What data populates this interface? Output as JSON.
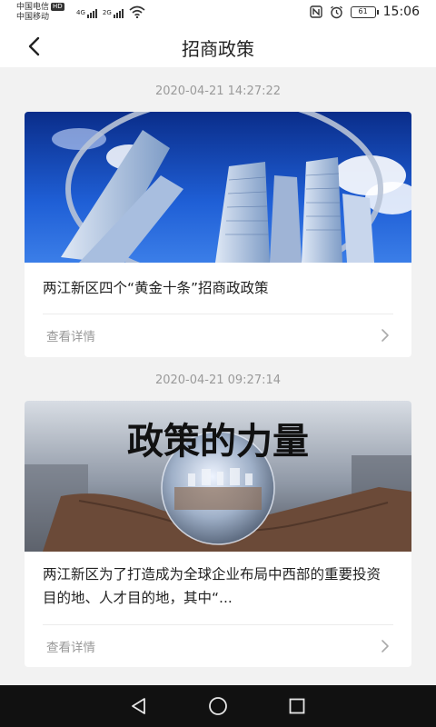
{
  "status_bar": {
    "carrier_1": "中国电信",
    "hd_badge": "HD",
    "carrier_2": "中国移动",
    "network_1": "4G",
    "network_2": "2G",
    "battery_level": "61",
    "time": "15:06"
  },
  "header": {
    "title": "招商政策"
  },
  "feed": [
    {
      "timestamp": "2020-04-21 14:27:22",
      "title": "两江新区四个“黄金十条”招商政政策",
      "more_label": "查看详情"
    },
    {
      "timestamp": "2020-04-21 09:27:14",
      "image_caption": "政策的力量",
      "title": "两江新区为了打造成为全球企业布局中西部的重要投资目的地、人才目的地，其中“...",
      "more_label": "查看详情"
    }
  ],
  "icons": {
    "back": "chevron-left-icon",
    "more": "chevron-right-icon",
    "nav_back": "triangle-back-icon",
    "nav_home": "circle-home-icon",
    "nav_recent": "square-recent-icon"
  }
}
